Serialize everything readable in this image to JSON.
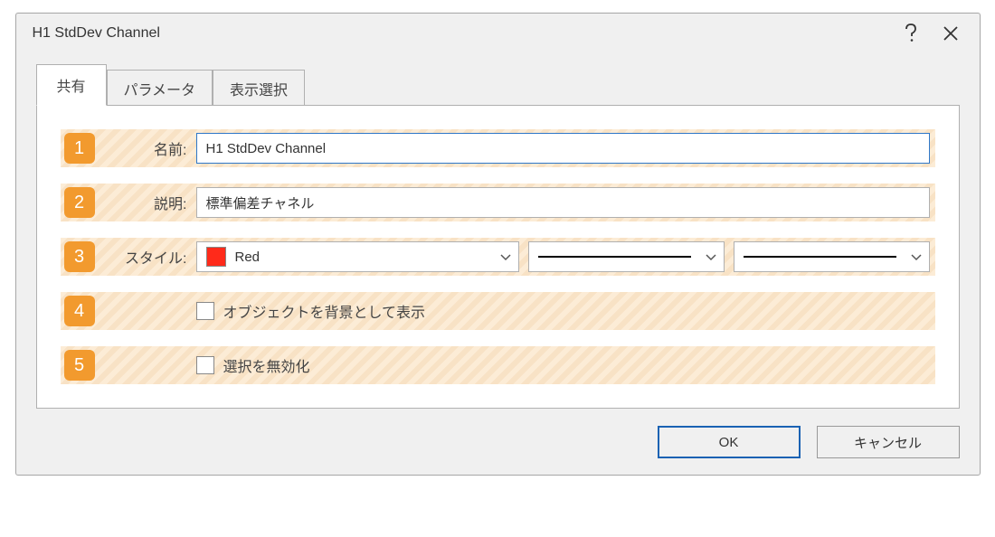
{
  "title": "H1 StdDev Channel",
  "tabs": {
    "share": "共有",
    "params": "パラメータ",
    "display": "表示選択"
  },
  "rows": {
    "r1": {
      "num": "1",
      "label": "名前:",
      "value": "H1 StdDev Channel"
    },
    "r2": {
      "num": "2",
      "label": "説明:",
      "value": "標準偏差チャネル"
    },
    "r3": {
      "num": "3",
      "label": "スタイル:",
      "color_name": "Red"
    },
    "r4": {
      "num": "4",
      "label": "",
      "chk_label": "オブジェクトを背景として表示"
    },
    "r5": {
      "num": "5",
      "label": "",
      "chk_label": "選択を無効化"
    }
  },
  "buttons": {
    "ok": "OK",
    "cancel": "キャンセル"
  }
}
